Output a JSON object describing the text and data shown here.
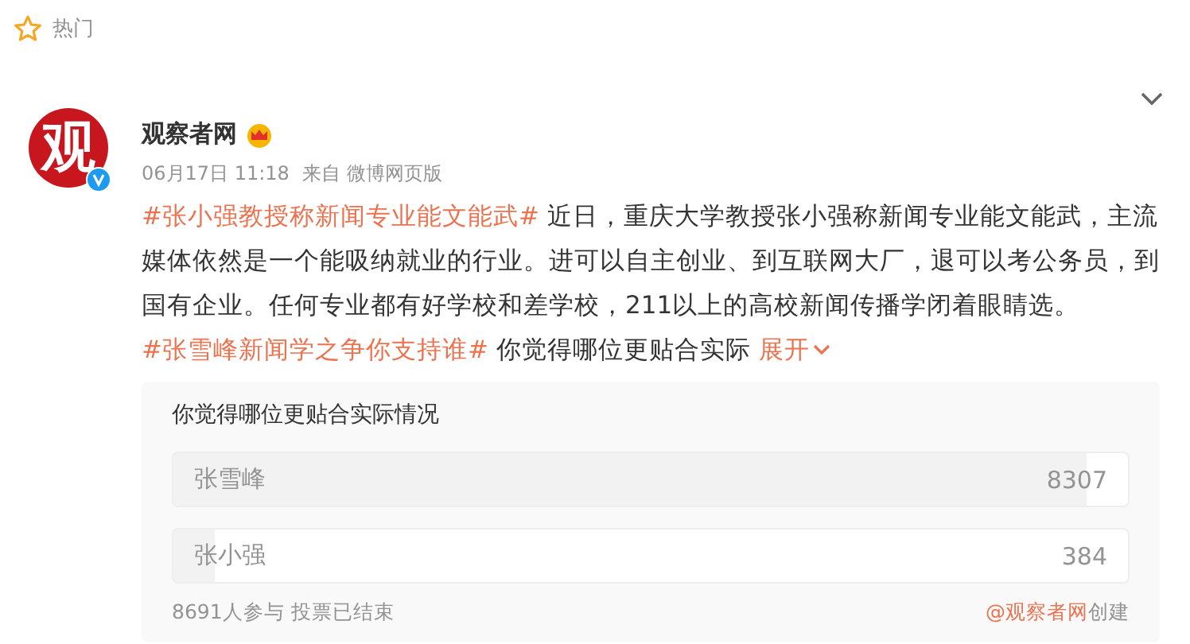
{
  "section": {
    "label": "热门"
  },
  "post": {
    "author": "观察者网",
    "avatar_text": "观",
    "verified": true,
    "crown": true,
    "time": "06月17日 11:18",
    "source": "来自 微博网页版",
    "body": [
      {
        "kind": "hashtag",
        "text": "#张小强教授称新闻专业能文能武#"
      },
      {
        "kind": "text",
        "text": " 近日，重庆大学教授张小强称新闻专业能文能武，主流媒体依然是一个能吸纳就业的行业。进可以自主创业、到互联网大厂，退可以考公务员，到国有企业。任何专业都有好学校和差学校，211以上的高校新闻传播学闭着眼睛选。"
      },
      {
        "kind": "hashtag",
        "text": "#张雪峰新闻学之争你支持谁#"
      },
      {
        "kind": "text",
        "text": " 你觉得哪位更贴合实际 "
      },
      {
        "kind": "expand",
        "text": "展开"
      }
    ],
    "poll": {
      "title": "你觉得哪位更贴合实际情况",
      "options": [
        {
          "label": "张雪峰",
          "count": "8307",
          "level": 0.956
        },
        {
          "label": "张小强",
          "count": "384",
          "level": 0.044
        }
      ],
      "participants": "8691人参与 投票已结束",
      "creator_link": "@观察者网",
      "creator_suffix": "创建"
    }
  }
}
